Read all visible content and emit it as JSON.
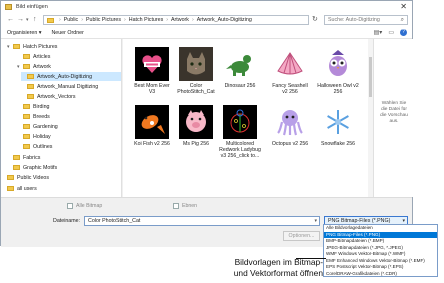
{
  "window": {
    "title": "Bild einfügen"
  },
  "address": {
    "crumbs": [
      "Public",
      "Public Pictures",
      "Hatch Pictures",
      "Artwork",
      "Artwork_Auto-Digitizing"
    ],
    "search_placeholder": "Suche: Auto-Digitizing"
  },
  "toolbar": {
    "organize_label": "Organisieren ▾",
    "new_folder_label": "Neuer Ordner"
  },
  "nav": {
    "items": [
      {
        "label": "Hatch Pictures",
        "selected": false
      },
      {
        "label": "Articles",
        "selected": false
      },
      {
        "label": "Artwork",
        "selected": false
      },
      {
        "label": "Artwork_Auto-Digitizing",
        "selected": true
      },
      {
        "label": "Artwork_Manual Digitizing",
        "selected": false
      },
      {
        "label": "Artwork_Vectors",
        "selected": false
      },
      {
        "label": "Birding",
        "selected": false
      },
      {
        "label": "Breeds",
        "selected": false
      },
      {
        "label": "Gardening",
        "selected": false
      },
      {
        "label": "Holiday",
        "selected": false
      },
      {
        "label": "Outlines",
        "selected": false
      },
      {
        "label": "Fabrics",
        "selected": false
      },
      {
        "label": "Graphic Motifs",
        "selected": false
      },
      {
        "label": "Public Videos",
        "selected": false
      },
      {
        "label": "all users",
        "selected": false
      }
    ]
  },
  "files": [
    {
      "caption": "Best Mom Ever V3",
      "icon": "heart-badge-icon"
    },
    {
      "caption": "Color PhotoStitch_Cat",
      "icon": "cat-photo-icon"
    },
    {
      "caption": "Dinosaur 256",
      "icon": "dinosaur-icon"
    },
    {
      "caption": "Fancy Seashell v2 256",
      "icon": "seashell-icon"
    },
    {
      "caption": "Halloween Owl v2 256",
      "icon": "owl-icon"
    },
    {
      "caption": "Koi Fish v2 256",
      "icon": "koi-fish-icon"
    },
    {
      "caption": "Ms Pig 256",
      "icon": "pig-icon"
    },
    {
      "caption": "Multicolored Redwork Ladybug v3 256_click to...",
      "icon": "ladybug-icon"
    },
    {
      "caption": "Octopus v2 256",
      "icon": "octopus-icon"
    },
    {
      "caption": "Snowflake 256",
      "icon": "snowflake-icon"
    }
  ],
  "preview": {
    "text": "Wählen Sie die Datei für die Vorschau aus."
  },
  "bottom": {
    "all_bitmap_label": "Alle Bitmap",
    "ebnen_label": "Ebnen",
    "filename_label": "Dateiname:",
    "filename_value": "Color PhotoStitch_Cat",
    "filter_value": "PNG Bitmap-Files (*.PNG)",
    "options_label": "Optionen..."
  },
  "dropdown": {
    "options": [
      "Alle Bildvorlagedateien",
      "PNG Bitmap-Files (*.PNG)",
      "BMP-Bitmapdateien (*.BMP)",
      "JPEG-Bitmapdateien (*.JPG, *.JPEG)",
      "WMF Windows Vektor-Bitmap (*.WMF)",
      "EMF Enhanced Windows Vektor-Bitmap (*.EMF)",
      "EPS Postscript Vektor-Bitmap (*.EPS)",
      "CorelDRAW-Grafikdateien (*.CDR)"
    ],
    "highlighted_index": 1
  },
  "annotation": {
    "line1": "Bildvorlagen im Bitmap-",
    "line2": "und Vektorformat öffnen"
  },
  "colors": {
    "selection": "#cce8ff",
    "accent": "#0078d7",
    "folder": "#f2c94c"
  }
}
